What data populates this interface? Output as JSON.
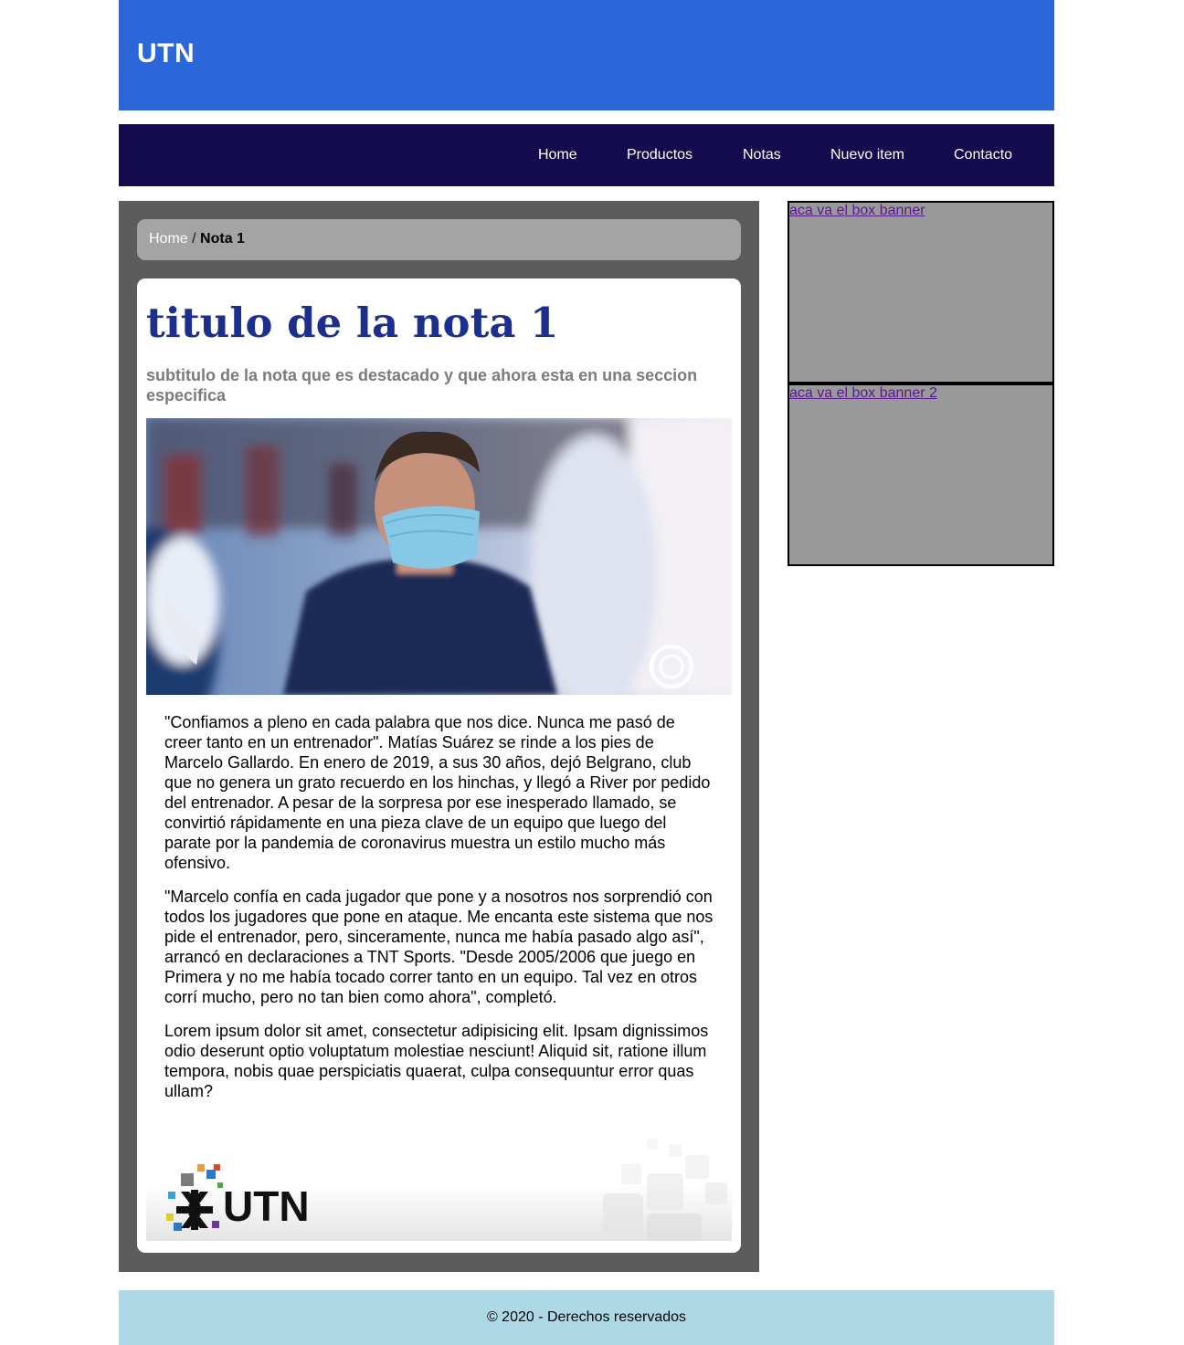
{
  "brand": "UTN",
  "nav": {
    "items": [
      "Home",
      "Productos",
      "Notas",
      "Nuevo item",
      "Contacto"
    ]
  },
  "breadcrumb": {
    "home": "Home",
    "separator": " / ",
    "current": "Nota 1"
  },
  "article": {
    "title": "titulo de la nota 1",
    "subtitle": "subtitulo de la nota que es destacado y que ahora esta en una seccion especifica",
    "paragraphs": [
      "\"Confiamos a pleno en cada palabra que nos dice. Nunca me pasó de creer tanto en un entrenador\". Matías Suárez se rinde a los pies de Marcelo Gallardo. En enero de 2019, a sus 30 años, dejó Belgrano, club que no genera un grato recuerdo en los hinchas, y llegó a River por pedido del entrenador. A pesar de la sorpresa por ese inesperado llamado, se convirtió rápidamente en una pieza clave de un equipo que luego del parate por la pandemia de coronavirus muestra un estilo mucho más ofensivo.",
      "\"Marcelo confía en cada jugador que pone y a nosotros nos sorprendió con todos los jugadores que pone en ataque. Me encanta este sistema que nos pide el entrenador, pero, sinceramente, nunca me había pasado algo así\", arrancó en declaraciones a TNT Sports. \"Desde 2005/2006 que juego en Primera y no me había tocado correr tanto en un equipo. Tal vez en otros corrí mucho, pero no tan bien como ahora\", completó.",
      "Lorem ipsum dolor sit amet, consectetur adipisicing elit. Ipsam dignissimos odio deserunt optio voluptatum molestiae nesciunt! Aliquid sit, ratione illum tempora, nobis quae perspiciatis quaerat, culpa consequuntur error quas ullam?"
    ],
    "logo_text": "UTN"
  },
  "sidebar": {
    "banner1": "aca va el box banner",
    "banner2": " aca va el box banner 2"
  },
  "footer": "© 2020 - Derechos reservados",
  "colors": {
    "header": "#2b67d8",
    "nav": "#140a4e",
    "main": "#5c5c5c",
    "breadcrumb": "#a4a4a4",
    "title": "#1d2f8c",
    "banner": "#999999",
    "footer": "#add8e6"
  }
}
